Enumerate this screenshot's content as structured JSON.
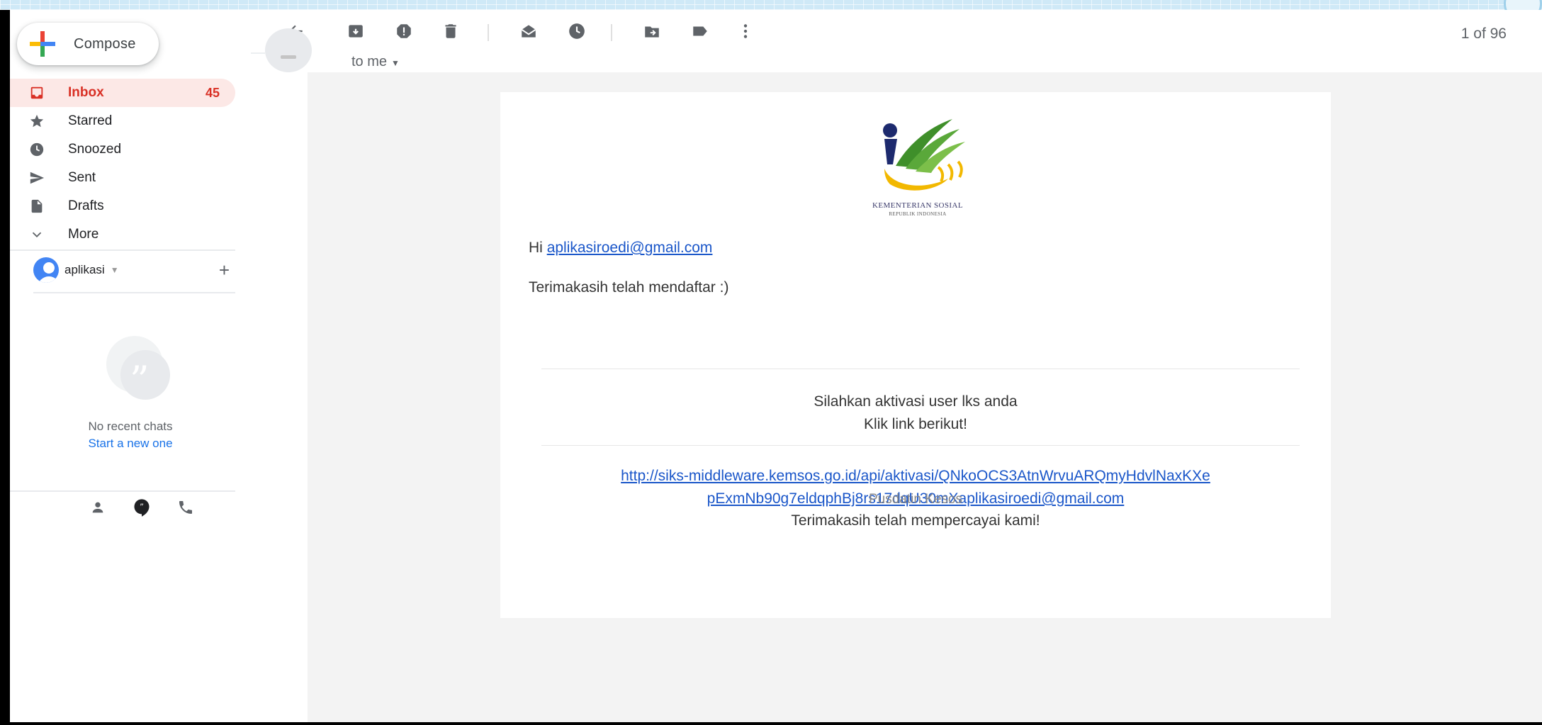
{
  "compose": {
    "label": "Compose"
  },
  "nav": [
    {
      "label": "Inbox",
      "count": "45",
      "icon": "inbox-icon",
      "active": true
    },
    {
      "label": "Starred",
      "icon": "star-icon"
    },
    {
      "label": "Snoozed",
      "icon": "clock-icon"
    },
    {
      "label": "Sent",
      "icon": "send-icon"
    },
    {
      "label": "Drafts",
      "icon": "draft-icon"
    },
    {
      "label": "More",
      "icon": "chevron-down-icon"
    }
  ],
  "account": {
    "name": "aplikasi",
    "add_symbol": "+"
  },
  "chats": {
    "empty_text": "No recent chats",
    "start_link": "Start a new one"
  },
  "toolbar": {
    "pager": "1 of 96"
  },
  "email": {
    "recipient": "to me",
    "logo_line1": "KEMENTERIAN SOSIAL",
    "logo_line2": "REPUBLIK INDONESIA",
    "greeting": "Hi",
    "greeting_email": "aplikasiroedi@gmail.com",
    "thanks_register": "Terimakasih telah mendaftar :)",
    "instruction_line1": "Silahkan aktivasi user lks anda",
    "instruction_line2": "Klik link berikut!",
    "activation_link_line1": "http://siks-middleware.kemsos.go.id/api/aktivasi/QNkoOCS3AtnWrvuARQmyHdvlNaxKXe",
    "activation_link_line2": "pExmNb90g7eldqphBj8rs17dqU30mXaplikasiroedi@gmail.com",
    "closing": "Terimakasih telah mempercayai kami!",
    "footer": "Pusdatin Kesos"
  },
  "colors": {
    "accent_red": "#d93025",
    "link_blue": "#1a56c9",
    "inbox_highlight": "#fce8e6",
    "logo_green": "#4a9a2a",
    "logo_gold": "#f2b800",
    "logo_navy": "#1d2a6e"
  }
}
